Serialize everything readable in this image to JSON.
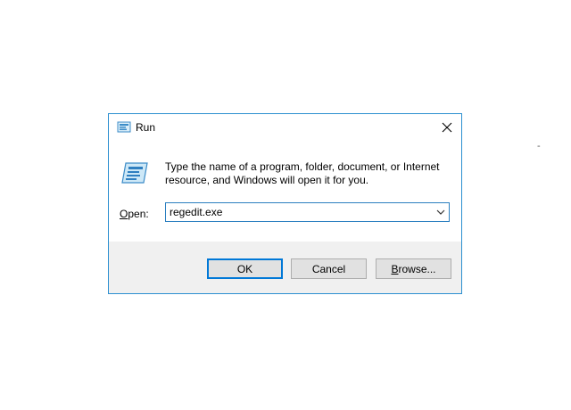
{
  "dialog": {
    "title": "Run",
    "description": "Type the name of a program, folder, document, or Internet resource, and Windows will open it for you.",
    "open_label_accel": "O",
    "open_label_rest": "pen:",
    "input_value": "regedit.exe",
    "buttons": {
      "ok": "OK",
      "cancel": "Cancel",
      "browse_accel": "B",
      "browse_rest": "rowse..."
    }
  },
  "desktop": {
    "stray_mark": "-"
  },
  "colors": {
    "window_border": "#2b8fd0",
    "footer_bg": "#f0f0f0",
    "default_button_border": "#0078d7",
    "button_bg": "#e1e1e1"
  },
  "icons": {
    "title": "run-icon",
    "close": "close-icon",
    "large": "run-icon",
    "dropdown": "chevron-down-icon"
  }
}
